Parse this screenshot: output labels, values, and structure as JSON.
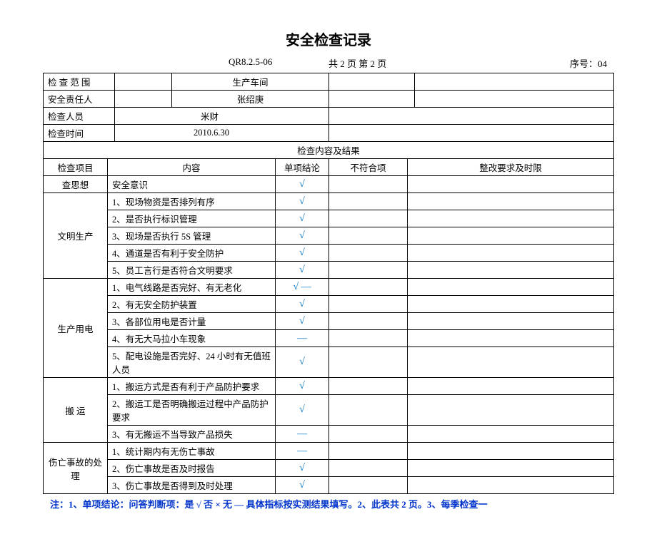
{
  "title": "安全检查记录",
  "meta": {
    "docno": "QR8.2.5-06",
    "pages": "共 2 页  第 2 页",
    "seq": "序号：04"
  },
  "header_table": {
    "scope_label": "检 查 范 围",
    "scope_value": "生产车间",
    "resp_label": "安全责任人",
    "resp_value": "张绍庚",
    "inspector_label": "检查人员",
    "inspector_value": "米财",
    "time_label": "检查时间",
    "time_value": "2010.6.30"
  },
  "section_header": "检查内容及结果",
  "cols": {
    "cat": "检查项目",
    "content": "内容",
    "single": "单项结论",
    "nonconf": "不符合项",
    "requirement": "整改要求及时限"
  },
  "groups": [
    {
      "name": "查思想",
      "rows": [
        {
          "content": "安全意识",
          "result": "√"
        }
      ]
    },
    {
      "name": "文明生产",
      "rows": [
        {
          "content": "1、现场物资是否排列有序",
          "result": "√"
        },
        {
          "content": "2、是否执行标识管理",
          "result": "√"
        },
        {
          "content": "3、现场是否执行 5S 管理",
          "result": "√"
        },
        {
          "content": "4、通道是否有利于安全防护",
          "result": "√"
        },
        {
          "content": "5、员工言行是否符合文明要求",
          "result": "√"
        }
      ]
    },
    {
      "name": "生产用电",
      "rows": [
        {
          "content": "1、电气线路是否完好、有无老化",
          "result": "√ —"
        },
        {
          "content": "2、有无安全防护装置",
          "result": "√"
        },
        {
          "content": "3、各部位用电是否计量",
          "result": "√"
        },
        {
          "content": "4、有无大马拉小车现象",
          "result": "—"
        },
        {
          "content": "5、配电设施是否完好、24 小时有无值班人员",
          "result": "√"
        }
      ]
    },
    {
      "name": "搬    运",
      "rows": [
        {
          "content": "1、搬运方式是否有利于产品防护要求",
          "result": "√"
        },
        {
          "content": "2、搬运工是否明确搬运过程中产品防护要求",
          "result": "√"
        },
        {
          "content": "3、有无搬运不当导致产品损失",
          "result": "—"
        }
      ]
    },
    {
      "name": "伤亡事故的处理",
      "rows": [
        {
          "content": "1、统计期内有无伤亡事故",
          "result": "—"
        },
        {
          "content": "2、伤亡事故是否及时报告",
          "result": "√"
        },
        {
          "content": "3、伤亡事故是否得到及时处理",
          "result": "√"
        }
      ]
    }
  ],
  "footnote": "注：1、单项结论：问答判断项：是 √    否 ×    无 —  具体指标按实测结果填写。2、此表共 2 页。3、每季检查一"
}
